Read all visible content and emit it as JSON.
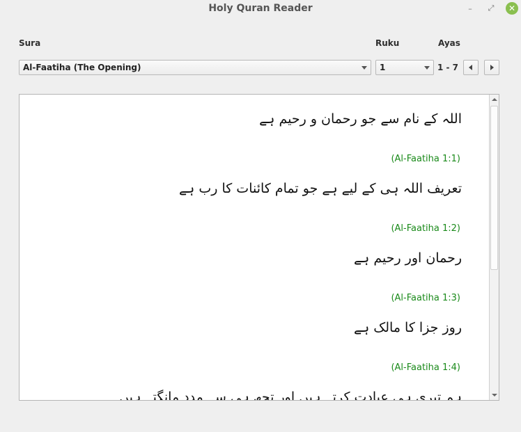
{
  "window": {
    "title": "Holy Quran Reader",
    "minimize_icon": "minimize-icon",
    "maximize_icon": "maximize-icon",
    "close_icon": "close-icon"
  },
  "controls": {
    "sura_label": "Sura",
    "ruku_label": "Ruku",
    "ayas_label": "Ayas",
    "sura_selected": "Al-Faatiha (The Opening)",
    "ruku_selected": "1",
    "ayas_range": "1 - 7"
  },
  "verses": [
    {
      "text": "اللہ کے نام سے جو رحمان و رحیم ہے",
      "ref": "(Al-Faatiha 1:1)"
    },
    {
      "text": "تعریف اللہ ہی کے لیے ہے جو تمام کائنات کا رب ہے",
      "ref": "(Al-Faatiha 1:2)"
    },
    {
      "text": "رحمان اور رحیم ہے",
      "ref": "(Al-Faatiha 1:3)"
    },
    {
      "text": "روز جزا کا مالک ہے",
      "ref": "(Al-Faatiha 1:4)"
    },
    {
      "text": "ہم تیری ہی عبادت کرتے ہیں اور تجھ ہی سے مدد مانگتے ہیں",
      "ref": ""
    }
  ],
  "colors": {
    "reference": "#1a8a1a",
    "close_button": "#8abf4f"
  }
}
